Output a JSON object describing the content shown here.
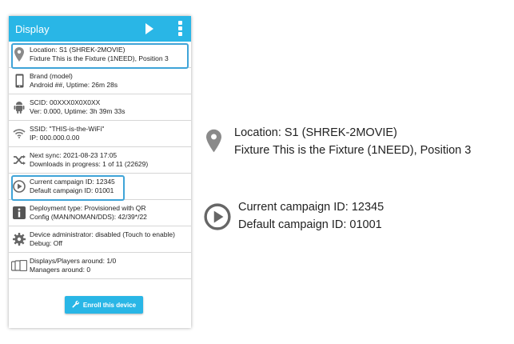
{
  "app": {
    "title": "Display"
  },
  "rows": [
    {
      "icon": "location-pin-icon",
      "line1": "Location: S1 (SHREK-2MOVIE)",
      "line2": "Fixture This is the Fixture (1NEED), Position 3"
    },
    {
      "icon": "phone-icon",
      "line1": "Brand (model)",
      "line2": "Android ##, Uptime: 26m 28s"
    },
    {
      "icon": "android-icon",
      "line1": "SCID: 00XXX0X0X0XX",
      "line2": "Ver: 0.000, Uptime: 3h 39m 33s"
    },
    {
      "icon": "wifi-icon",
      "line1": "SSID: \"THIS-is-the-WiFi\"",
      "line2": "IP: 000.000.0.00"
    },
    {
      "icon": "shuffle-icon",
      "line1": "Next sync: 2021-08-23 17:05",
      "line2": "Downloads in progress: 1 of 11 (22629)"
    },
    {
      "icon": "play-circle-icon",
      "line1": "Current campaign ID: 12345",
      "line2": "Default campaign ID: 01001"
    },
    {
      "icon": "info-icon",
      "line1": "Deployment type: Provisioned with QR",
      "line2": "Config (MAN/NOMAN/DDS): 42/39*/22"
    },
    {
      "icon": "gear-icon",
      "line1": "Device administrator: disabled (Touch to enable)",
      "line2": "Debug: Off"
    },
    {
      "icon": "devices-icon",
      "line1": "Displays/Players around: 1/0",
      "line2": "Managers around: 0"
    }
  ],
  "enroll_button": {
    "label": "Enroll this device",
    "icon": "wrench-icon"
  },
  "zoom_location": {
    "icon": "location-pin-icon",
    "label1": "Location:",
    "value1": "S1 (SHREK-2MOVIE)",
    "label2": "Fixture",
    "value2": "This is the Fixture (1NEED), Position 3"
  },
  "zoom_campaign": {
    "icon": "play-circle-icon",
    "line1": "Current campaign ID: 12345",
    "line2": "Default campaign ID: 01001"
  },
  "colors": {
    "accent": "#29b6e6",
    "highlight": "#3fa4d8",
    "icon_gray": "#7a7a7a"
  }
}
